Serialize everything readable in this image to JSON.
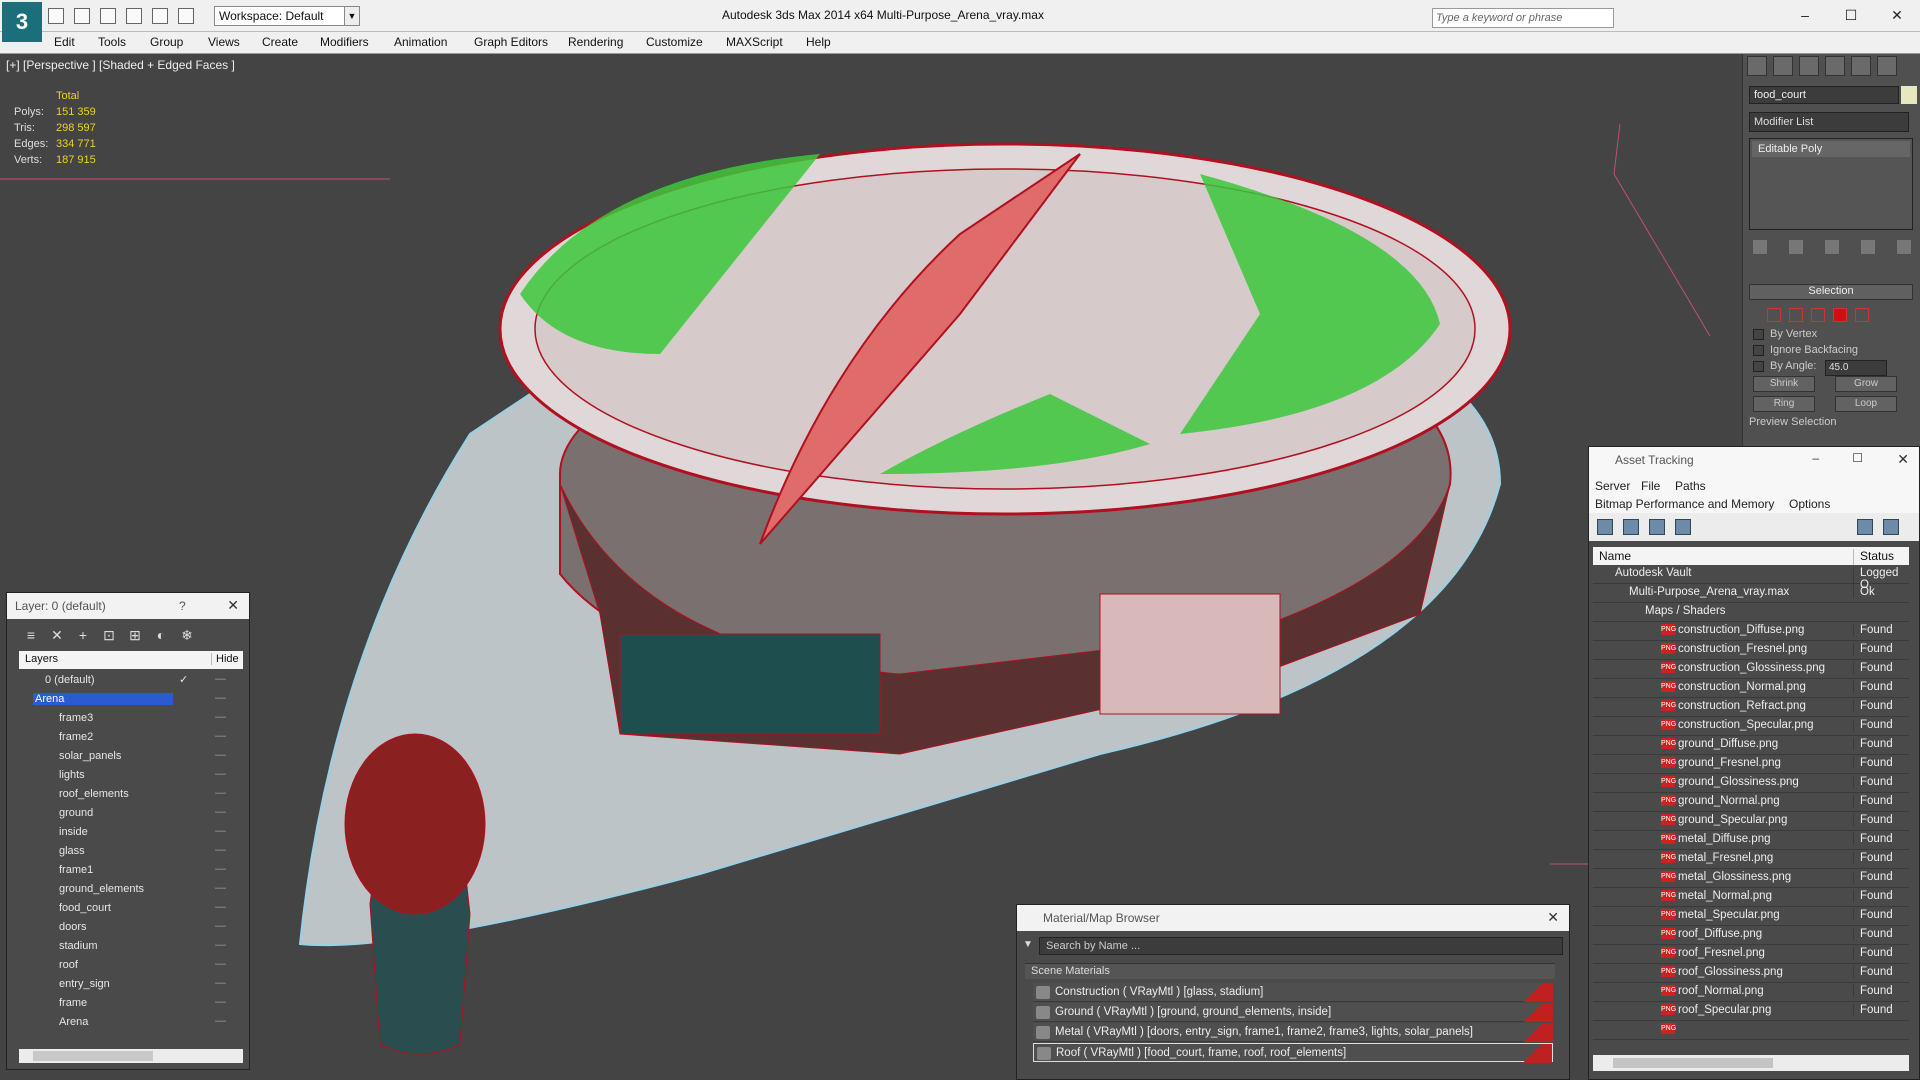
{
  "app": {
    "title": "Autodesk 3ds Max  2014 x64      Multi-Purpose_Arena_vray.max",
    "workspace": "Workspace: Default",
    "search_placeholder": "Type a keyword or phrase",
    "logo_icon": "3ds-max-logo-icon"
  },
  "menu": [
    "Edit",
    "Tools",
    "Group",
    "Views",
    "Create",
    "Modifiers",
    "Animation",
    "Graph Editors",
    "Rendering",
    "Customize",
    "MAXScript",
    "Help"
  ],
  "viewport": {
    "label": "[+] [Perspective ] [Shaded + Edged Faces ]",
    "stats": {
      "header": "Total",
      "rows": [
        {
          "k": "Polys:",
          "v": "151 359"
        },
        {
          "k": "Tris:",
          "v": "298 597"
        },
        {
          "k": "Edges:",
          "v": "334 771"
        },
        {
          "k": "Verts:",
          "v": "187 915"
        }
      ]
    }
  },
  "command_panel": {
    "object_name": "food_court",
    "modifier_list": "Modifier List",
    "stack_item": "Editable Poly",
    "selection_title": "Selection",
    "by_vertex": "By Vertex",
    "ignore_backfacing": "Ignore Backfacing",
    "by_angle": "By Angle:",
    "angle_value": "45.0",
    "shrink": "Shrink",
    "grow": "Grow",
    "ring": "Ring",
    "loop": "Loop",
    "preview_selection": "Preview Selection"
  },
  "layers": {
    "title": "Layer: 0 (default)",
    "help": "?",
    "col_layers": "Layers",
    "col_hide": "Hide",
    "rows": [
      {
        "name": "0 (default)"
      },
      {
        "name": "Arena"
      },
      {
        "name": "frame3"
      },
      {
        "name": "frame2"
      },
      {
        "name": "solar_panels"
      },
      {
        "name": "lights"
      },
      {
        "name": "roof_elements"
      },
      {
        "name": "ground"
      },
      {
        "name": "inside"
      },
      {
        "name": "glass"
      },
      {
        "name": "frame1"
      },
      {
        "name": "ground_elements"
      },
      {
        "name": "food_court"
      },
      {
        "name": "doors"
      },
      {
        "name": "stadium"
      },
      {
        "name": "roof"
      },
      {
        "name": "entry_sign"
      },
      {
        "name": "frame"
      },
      {
        "name": "Arena"
      }
    ]
  },
  "asset_tracking": {
    "title": "Asset Tracking",
    "menu1": [
      "Server",
      "File",
      "Paths"
    ],
    "menu2": [
      "Bitmap Performance and Memory",
      "Options"
    ],
    "col_name": "Name",
    "col_status": "Status",
    "rows": [
      {
        "name": "Autodesk Vault",
        "status": "Logged O",
        "indent": 1,
        "type": "vault"
      },
      {
        "name": "Multi-Purpose_Arena_vray.max",
        "status": "Ok",
        "indent": 2,
        "type": "max"
      },
      {
        "name": "Maps / Shaders",
        "status": "",
        "indent": 3,
        "type": "folder"
      },
      {
        "name": "construction_Diffuse.png",
        "status": "Found",
        "indent": 4,
        "type": "png"
      },
      {
        "name": "construction_Fresnel.png",
        "status": "Found",
        "indent": 4,
        "type": "png"
      },
      {
        "name": "construction_Glossiness.png",
        "status": "Found",
        "indent": 4,
        "type": "png"
      },
      {
        "name": "construction_Normal.png",
        "status": "Found",
        "indent": 4,
        "type": "png"
      },
      {
        "name": "construction_Refract.png",
        "status": "Found",
        "indent": 4,
        "type": "png"
      },
      {
        "name": "construction_Specular.png",
        "status": "Found",
        "indent": 4,
        "type": "png"
      },
      {
        "name": "ground_Diffuse.png",
        "status": "Found",
        "indent": 4,
        "type": "png"
      },
      {
        "name": "ground_Fresnel.png",
        "status": "Found",
        "indent": 4,
        "type": "png"
      },
      {
        "name": "ground_Glossiness.png",
        "status": "Found",
        "indent": 4,
        "type": "png"
      },
      {
        "name": "ground_Normal.png",
        "status": "Found",
        "indent": 4,
        "type": "png"
      },
      {
        "name": "ground_Specular.png",
        "status": "Found",
        "indent": 4,
        "type": "png"
      },
      {
        "name": "metal_Diffuse.png",
        "status": "Found",
        "indent": 4,
        "type": "png"
      },
      {
        "name": "metal_Fresnel.png",
        "status": "Found",
        "indent": 4,
        "type": "png"
      },
      {
        "name": "metal_Glossiness.png",
        "status": "Found",
        "indent": 4,
        "type": "png"
      },
      {
        "name": "metal_Normal.png",
        "status": "Found",
        "indent": 4,
        "type": "png"
      },
      {
        "name": "metal_Specular.png",
        "status": "Found",
        "indent": 4,
        "type": "png"
      },
      {
        "name": "roof_Diffuse.png",
        "status": "Found",
        "indent": 4,
        "type": "png"
      },
      {
        "name": "roof_Fresnel.png",
        "status": "Found",
        "indent": 4,
        "type": "png"
      },
      {
        "name": "roof_Glossiness.png",
        "status": "Found",
        "indent": 4,
        "type": "png"
      },
      {
        "name": "roof_Normal.png",
        "status": "Found",
        "indent": 4,
        "type": "png"
      },
      {
        "name": "roof_Specular.png",
        "status": "Found",
        "indent": 4,
        "type": "png"
      }
    ]
  },
  "material_browser": {
    "title": "Material/Map Browser",
    "search_placeholder": "Search by Name ...",
    "section": "Scene Materials",
    "rows": [
      {
        "name": "Construction  ( VRayMtl ) [glass, stadium]"
      },
      {
        "name": "Ground  ( VRayMtl ) [ground, ground_elements, inside]"
      },
      {
        "name": "Metal  ( VRayMtl ) [doors, entry_sign, frame1, frame2, frame3, lights, solar_panels]"
      },
      {
        "name": "Roof  ( VRayMtl ) [food_court, frame, roof, roof_elements]"
      }
    ]
  },
  "colors": {
    "accent": "#2a5bd0",
    "wire": "#b01020",
    "seats": "#3cc83c",
    "stats": "#f0d020"
  }
}
